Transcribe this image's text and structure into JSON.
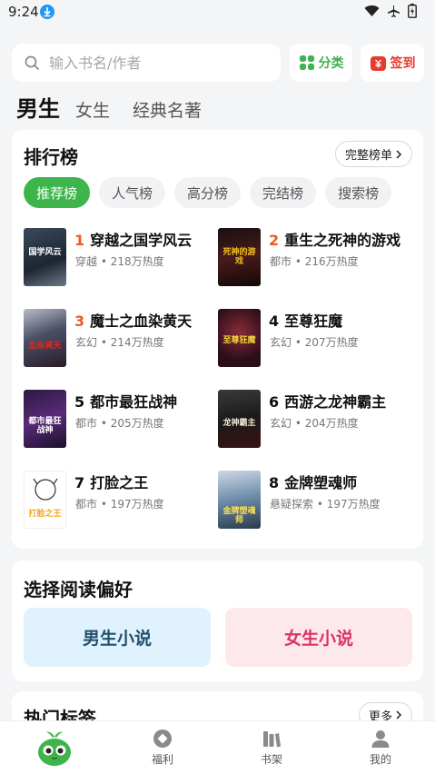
{
  "status_bar": {
    "time": "9:24"
  },
  "search": {
    "placeholder": "输入书名/作者",
    "value": ""
  },
  "header_buttons": {
    "category": "分类",
    "checkin": "签到"
  },
  "channel_tabs": [
    {
      "label": "男生",
      "active": true
    },
    {
      "label": "女生",
      "active": false
    },
    {
      "label": "经典名著",
      "active": false
    }
  ],
  "ranking": {
    "title": "排行榜",
    "full_list": "完整榜单",
    "tabs": [
      "推荐榜",
      "人气榜",
      "高分榜",
      "完结榜",
      "搜索榜"
    ],
    "active_tab": "推荐榜",
    "books": [
      {
        "rank": "1",
        "title": "穿越之国学风云",
        "genre": "穿越",
        "heat": "218万热度",
        "cover_text": "国学风云"
      },
      {
        "rank": "2",
        "title": "重生之死神的游戏",
        "genre": "都市",
        "heat": "216万热度",
        "cover_text": "死神的游戏"
      },
      {
        "rank": "3",
        "title": "魔士之血染黄天",
        "genre": "玄幻",
        "heat": "214万热度",
        "cover_text": "血染黄天"
      },
      {
        "rank": "4",
        "title": "至尊狂魔",
        "genre": "玄幻",
        "heat": "207万热度",
        "cover_text": "至尊狂魔"
      },
      {
        "rank": "5",
        "title": "都市最狂战神",
        "genre": "都市",
        "heat": "205万热度",
        "cover_text": "都市最狂战神"
      },
      {
        "rank": "6",
        "title": "西游之龙神霸主",
        "genre": "玄幻",
        "heat": "204万热度",
        "cover_text": "龙神霸主"
      },
      {
        "rank": "7",
        "title": "打脸之王",
        "genre": "都市",
        "heat": "197万热度",
        "cover_text": "打脸之王"
      },
      {
        "rank": "8",
        "title": "金牌塑魂师",
        "genre": "悬疑探索",
        "heat": "197万热度",
        "cover_text": "金牌塑魂师"
      }
    ]
  },
  "preference": {
    "title": "选择阅读偏好",
    "male": "男生小说",
    "female": "女生小说"
  },
  "hot_tags": {
    "title": "热门标签",
    "more": "更多"
  },
  "bottom_nav": [
    {
      "label": "",
      "icon": "mascot-icon"
    },
    {
      "label": "福利",
      "icon": "welfare-icon"
    },
    {
      "label": "书架",
      "icon": "bookshelf-icon"
    },
    {
      "label": "我的",
      "icon": "profile-icon"
    }
  ],
  "colors": {
    "accent_green": "#3db54a",
    "hot_rank": "#ef5a1d",
    "checkin_red": "#e8392f"
  }
}
